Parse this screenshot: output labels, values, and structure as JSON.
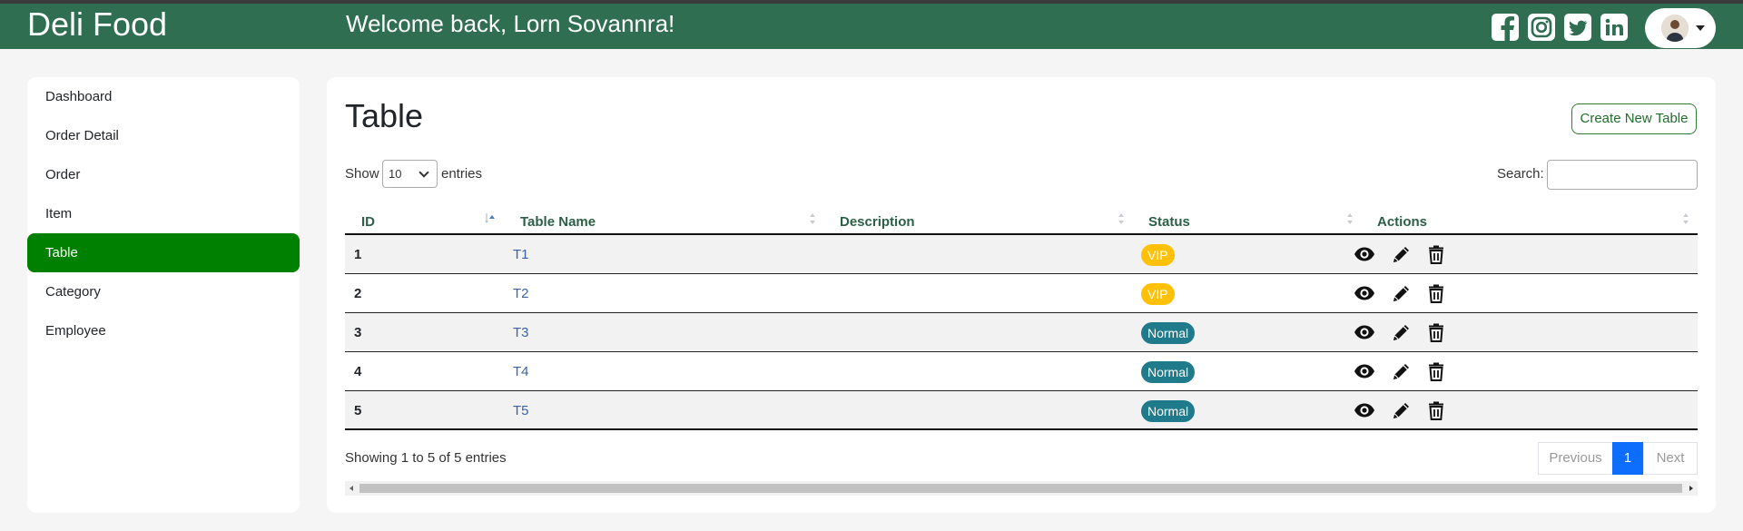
{
  "app": {
    "brand": "Deli Food",
    "welcome": "Welcome back, Lorn Sovannra!"
  },
  "header": {
    "social_icons": [
      "facebook-icon",
      "instagram-icon",
      "twitter-icon",
      "linkedin-icon"
    ],
    "brand_color": "#2f6e50"
  },
  "sidebar": {
    "items": [
      {
        "label": "Dashboard",
        "active": false
      },
      {
        "label": "Order Detail",
        "active": false
      },
      {
        "label": "Order",
        "active": false
      },
      {
        "label": "Item",
        "active": false
      },
      {
        "label": "Table",
        "active": true
      },
      {
        "label": "Category",
        "active": false
      },
      {
        "label": "Employee",
        "active": false
      }
    ],
    "active_color": "#008000"
  },
  "main": {
    "title": "Table",
    "create_label": "Create New Table",
    "show_label": "Show",
    "page_length": "10",
    "entries_label": "entries",
    "search_label": "Search:",
    "search_value": "",
    "columns": [
      "ID",
      "Table Name",
      "Description",
      "Status",
      "Actions"
    ],
    "rows": [
      {
        "id": "1",
        "name": "T1",
        "description": "",
        "status": "VIP"
      },
      {
        "id": "2",
        "name": "T2",
        "description": "",
        "status": "VIP"
      },
      {
        "id": "3",
        "name": "T3",
        "description": "",
        "status": "Normal"
      },
      {
        "id": "4",
        "name": "T4",
        "description": "",
        "status": "Normal"
      },
      {
        "id": "5",
        "name": "T5",
        "description": "",
        "status": "Normal"
      }
    ],
    "row_actions": [
      "eye-icon",
      "pencil-icon",
      "trash-icon"
    ],
    "info": "Showing 1 to 5 of 5 entries",
    "pagination": {
      "previous": "Previous",
      "current": "1",
      "next": "Next"
    },
    "status_colors": {
      "VIP": "#ffc107",
      "Normal": "#1f7a8c"
    }
  }
}
